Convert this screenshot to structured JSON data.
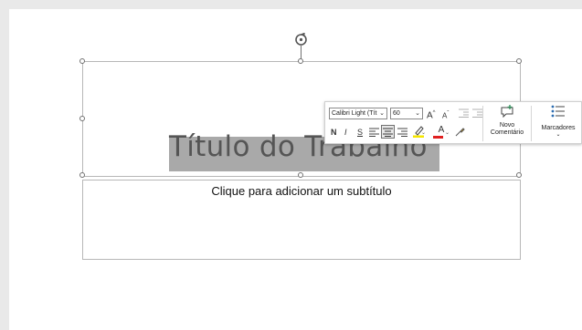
{
  "slide": {
    "title": "Título do Trabalho",
    "subtitle": "Clique para adicionar um subtítulo"
  },
  "mini_toolbar": {
    "font_name": "Calibri Light (Tít",
    "font_size": "60",
    "grow_font": "A",
    "shrink_font": "A",
    "bold": "N",
    "italic": "I",
    "underline": "S",
    "font_color_letter": "A",
    "new_comment_line1": "Novo",
    "new_comment_line2": "Comentário",
    "bullets_label": "Marcadores",
    "highlight_color": "#f5e600",
    "font_color": "#e02020"
  },
  "icons": [
    "rotate-icon",
    "dropdown-arrow-icon",
    "decrease-indent-icon",
    "increase-indent-icon",
    "align-left-icon",
    "align-center-icon",
    "align-right-icon",
    "highlighter-icon",
    "font-color-icon",
    "format-painter-icon",
    "new-comment-icon",
    "bullets-icon"
  ]
}
